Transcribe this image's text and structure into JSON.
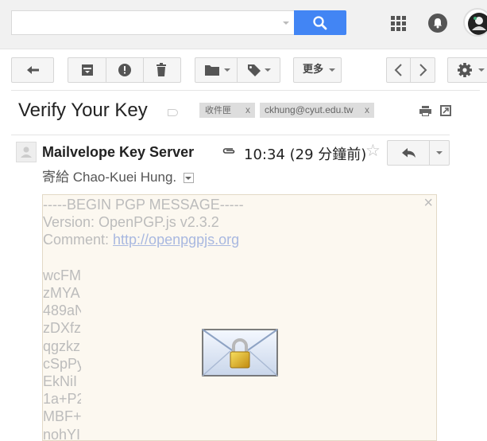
{
  "search": {
    "value": "",
    "placeholder": ""
  },
  "toolbar": {
    "more_label": "更多"
  },
  "message": {
    "subject": "Verify Your Key",
    "labels": [
      {
        "label": "收件匣",
        "remove": "x"
      },
      {
        "label": "ckhung@cyut.edu.tw",
        "remove": "x"
      }
    ],
    "sender": "Mailvelope Key Server",
    "time": "10:34 (29 分鐘前)",
    "to_prefix": "寄給",
    "to_name": "Chao-Kuei Hung."
  },
  "pgp": {
    "header_lines": [
      "-----BEGIN PGP MESSAGE-----",
      "Version: OpenPGP.js v2.3.2"
    ],
    "comment_prefix": "Comment: ",
    "comment_link": "http://openpgpjs.org",
    "body_lines": [
      "",
      "wcFM",
      "zMYA",
      "489aN",
      "zDXfz",
      "qgzkz",
      "cSpPy",
      "EkNiI",
      "1a+P2",
      "MBF+",
      "nohYI"
    ],
    "close": "×"
  },
  "colors": {
    "accent": "#4285f4"
  }
}
